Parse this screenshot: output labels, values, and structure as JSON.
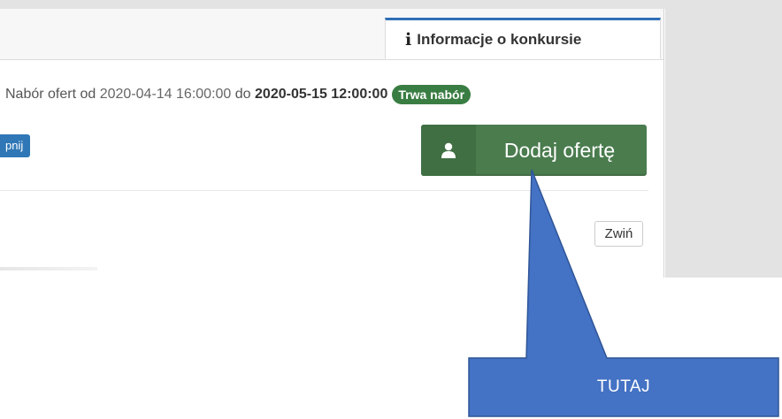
{
  "tab": {
    "info_label": "Informacje o konkursie"
  },
  "nabor": {
    "prefix": "Nabór ofert od",
    "start": "2020-04-14 16:00:00",
    "connector": "do",
    "end": "2020-05-15 12:00:00",
    "status": "Trwa nabór"
  },
  "left_button": {
    "label": "pnij"
  },
  "add_offer": {
    "label": "Dodaj ofertę",
    "icon": "user-icon"
  },
  "collapse": {
    "label": "Zwiń"
  },
  "callout": {
    "label": "TUTAJ"
  },
  "colors": {
    "accent_blue": "#2f77b6",
    "success_green": "#4a7c4e",
    "badge_green": "#3a7d43",
    "callout_blue": "#4472c4"
  }
}
